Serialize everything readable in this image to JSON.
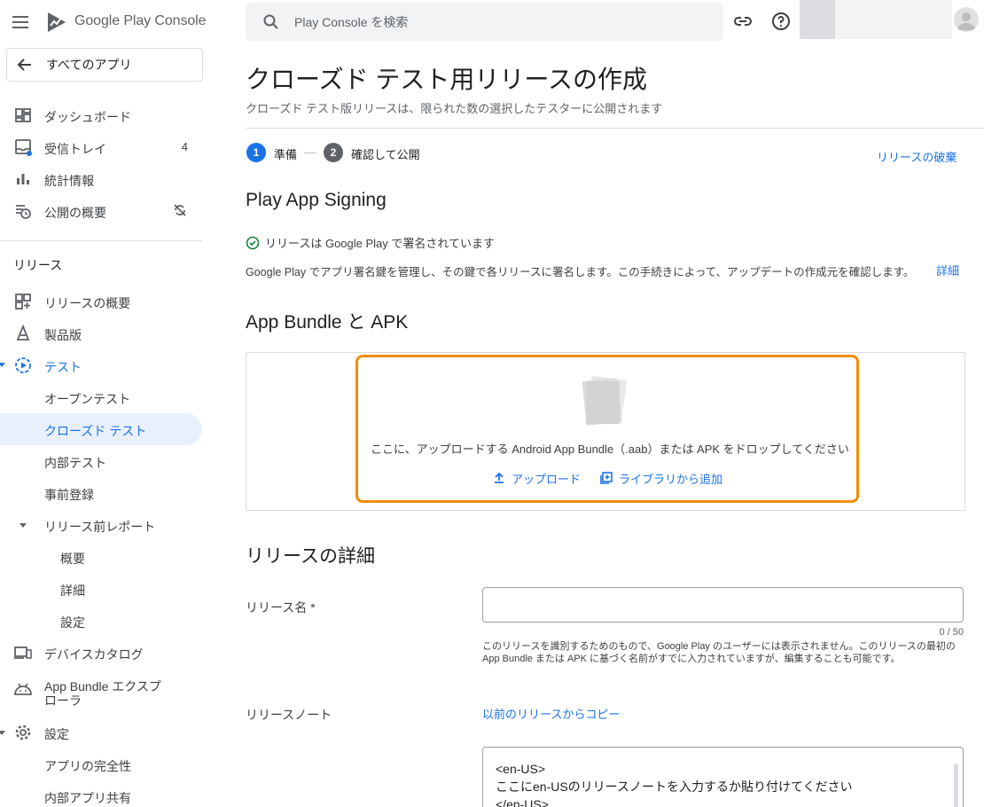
{
  "app": {
    "logo_text": "Google Play Console"
  },
  "sidebar": {
    "all_apps_label": "すべてのアプリ",
    "top_items": [
      {
        "label": "ダッシュボード",
        "icon": "dashboard-icon"
      },
      {
        "label": "受信トレイ",
        "icon": "inbox-icon",
        "count": "4"
      },
      {
        "label": "統計情報",
        "icon": "bar-chart-icon"
      },
      {
        "label": "公開の概要",
        "icon": "publishing-overview-icon"
      }
    ],
    "release_section_label": "リリース",
    "release_items": [
      {
        "label": "リリースの概要",
        "icon": "releases-overview-icon"
      },
      {
        "label": "製品版",
        "icon": "production-icon"
      },
      {
        "label": "テスト",
        "icon": "testing-icon"
      },
      {
        "label": "オープンテスト"
      },
      {
        "label": "クローズド テスト"
      },
      {
        "label": "内部テスト"
      },
      {
        "label": "事前登録"
      },
      {
        "label": "リリース前レポート"
      },
      {
        "label": "概要"
      },
      {
        "label": "詳細"
      },
      {
        "label": "設定"
      },
      {
        "label": "デバイスカタログ",
        "icon": "device-catalog-icon"
      },
      {
        "label": "App Bundle エクスプローラ",
        "icon": "app-bundle-explorer-icon"
      },
      {
        "label": "設定",
        "icon": "settings-icon"
      },
      {
        "label": "アプリの完全性"
      },
      {
        "label": "内部アプリ共有"
      }
    ]
  },
  "search": {
    "placeholder": "Play Console を検索"
  },
  "header": {
    "title": "クローズド テスト用リリースの作成",
    "subtitle": "クローズド テスト版リリースは、限られた数の選択したテスターに公開されます"
  },
  "steps": [
    {
      "number": "1",
      "label": "準備",
      "active": true
    },
    {
      "number": "2",
      "label": "確認して公開",
      "active": false
    }
  ],
  "discard_label": "リリースの破棄",
  "signing": {
    "heading": "Play App Signing",
    "status": "リリースは Google Play で署名されています",
    "description": "Google Play でアプリ署名鍵を管理し、その鍵で各リリースに署名します。この手続きによって、アップデートの作成元を確認します。",
    "more_link": "詳細"
  },
  "bundles": {
    "heading": "App Bundle と APK",
    "drop_text": "ここに、アップロードする Android App Bundle（.aab）または APK をドロップしてください",
    "upload_label": "アップロード",
    "library_label": "ライブラリから追加"
  },
  "release_details": {
    "heading": "リリースの詳細",
    "name_label": "リリース名 *",
    "name_value": "",
    "name_counter": "0 / 50",
    "name_help": "このリリースを識別するためのもので、Google Play のユーザーには表示されません。このリリースの最初の App Bundle または APK に基づく名前がすでに入力されていますが、編集することも可能です。",
    "notes_label": "リリースノート",
    "copy_link": "以前のリリースからコピー",
    "notes_value": "<en-US>\nここにen-USのリリースノートを入力するか貼り付けてください\n</en-US>"
  },
  "colors": {
    "accent": "#1a73e8",
    "highlight": "#f28c00",
    "success": "#188038"
  }
}
